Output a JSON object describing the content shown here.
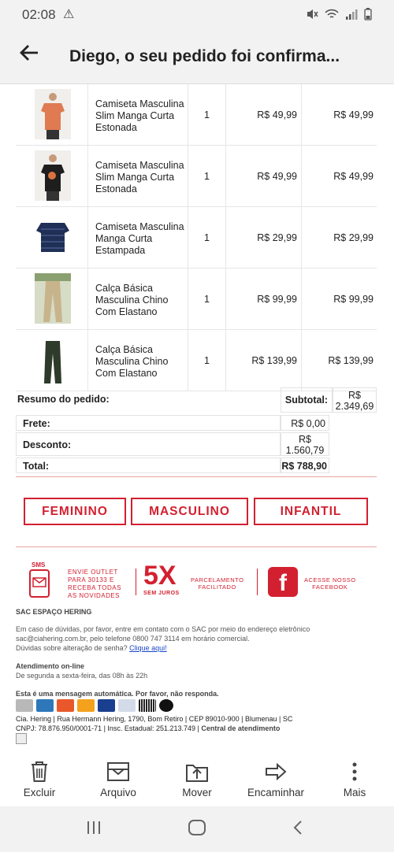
{
  "status": {
    "time": "02:08"
  },
  "header": {
    "title": "Diego, o seu pedido foi confirma..."
  },
  "products": [
    {
      "name": "Camiseta Masculina Slim Manga Curta Estonada",
      "qty": "1",
      "price": "R$ 49,99",
      "total": "R$ 49,99",
      "color": "#e07a52"
    },
    {
      "name": "Camiseta Masculina Slim Manga Curta Estonada",
      "qty": "1",
      "price": "R$ 49,99",
      "total": "R$ 49,99",
      "color": "#1e1e1e"
    },
    {
      "name": "Camiseta Masculina Manga Curta Estampada",
      "qty": "1",
      "price": "R$ 29,99",
      "total": "R$ 29,99",
      "color": "#1f2f55"
    },
    {
      "name": "Calça Básica Masculina Chino Com Elastano",
      "qty": "1",
      "price": "R$ 99,99",
      "total": "R$ 99,99",
      "color": "#c8b48c"
    },
    {
      "name": "Calça Básica Masculina Chino Com Elastano",
      "qty": "1",
      "price": "R$ 139,99",
      "total": "R$ 139,99",
      "color": "#2e3a2a"
    }
  ],
  "summary": {
    "title": "Resumo do pedido:",
    "subtotal_label": "Subtotal:",
    "subtotal_value_1": "R$",
    "subtotal_value_2": "2.349,69",
    "frete_label": "Frete:",
    "frete_value": "R$ 0,00",
    "desconto_label": "Desconto:",
    "desconto_value_1": "R$",
    "desconto_value_2": "1.560,79",
    "total_label": "Total:",
    "total_value": "R$ 788,90"
  },
  "categories": [
    "FEMININO",
    "MASCULINO",
    "INFANTIL"
  ],
  "promo": {
    "sms": "SMS",
    "outlet_1": "ENVIE OUTLET",
    "outlet_2": "PARA 30133 E",
    "outlet_3": "RECEBA TODAS",
    "outlet_4": "AS NOVIDADES",
    "five_x": "5X",
    "sem_juros": "SEM JUROS",
    "parcelamento_1": "PARCELAMENTO",
    "parcelamento_2": "FACILITADO",
    "facebook_1": "ACESSE NOSSO",
    "facebook_2": "FACEBOOK"
  },
  "footer": {
    "sac_title": "SAC ESPAÇO HERING",
    "sac_text_1": "Em caso de dúvidas, por favor, entre em contato com o SAC por meio do endereço eletrônico",
    "sac_text_2": "sac@ciahering.com.br, pelo telefone 0800 747 3114 em horário comercial.",
    "sac_text_3": "Dúvidas sobre alteração de senha?",
    "sac_link": "Clique aqui!",
    "online_title": "Atendimento on-line",
    "online_text": "De segunda a sexta-feira, das 08h às 22h",
    "auto_msg": "Esta é uma mensagem automática. Por favor, não responda.",
    "company_1": "Cia. Hering | Rua Hermann Hering, 1790, Bom Retiro | CEP 89010-900 | Blumenau | SC",
    "company_2a": "CNPJ: 78.876.950/0001-71 | Insc. Estadual: 251.213.749 |",
    "company_2b": "Central de atendimento"
  },
  "actions": {
    "delete": "Excluir",
    "archive": "Arquivo",
    "move": "Mover",
    "forward": "Encaminhar",
    "more": "Mais"
  }
}
